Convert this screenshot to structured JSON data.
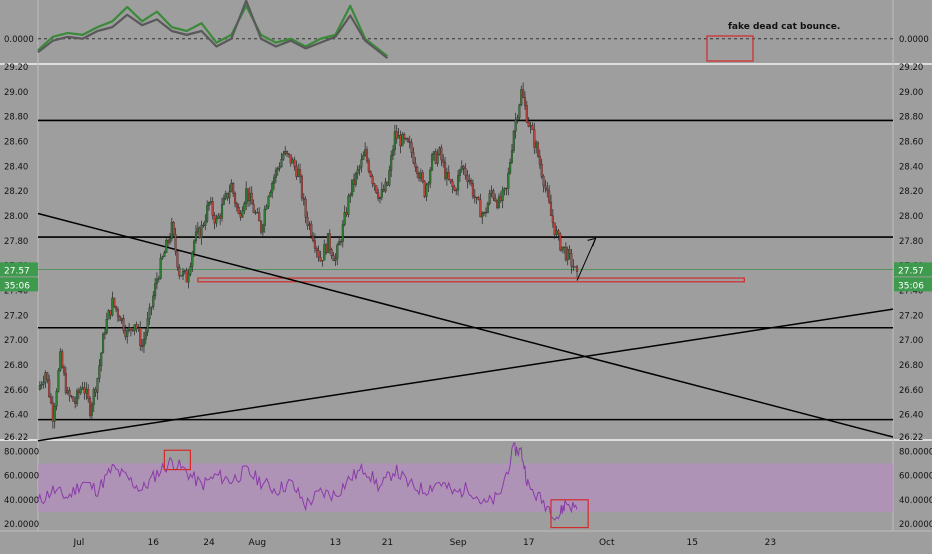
{
  "chart_data": [
    {
      "panel": "oscillator",
      "type": "line",
      "y_ticks": [
        "0.0000"
      ],
      "ylim": [
        -0.6,
        1.0
      ],
      "zero_line": true,
      "series": [
        {
          "color": "#3a8a3a",
          "x": [
            0,
            4,
            8,
            12,
            16,
            20,
            24,
            28,
            32,
            36,
            40,
            44,
            48,
            52,
            56,
            60,
            64,
            68,
            72,
            76,
            80,
            84,
            88,
            94
          ],
          "values": [
            -0.3,
            0.05,
            0.15,
            0.1,
            0.3,
            0.45,
            0.82,
            0.45,
            0.7,
            0.3,
            0.2,
            0.4,
            -0.1,
            0.1,
            0.85,
            0.1,
            -0.1,
            0.0,
            -0.2,
            0.0,
            0.1,
            0.85,
            0.0,
            -0.45
          ]
        },
        {
          "color": "#595959",
          "x": [
            0,
            4,
            8,
            12,
            16,
            20,
            24,
            28,
            32,
            36,
            40,
            44,
            48,
            52,
            56,
            60,
            64,
            68,
            72,
            76,
            80,
            84,
            88,
            94
          ],
          "values": [
            -0.35,
            -0.05,
            0.05,
            0.0,
            0.2,
            0.3,
            0.62,
            0.35,
            0.5,
            0.2,
            0.1,
            0.2,
            -0.2,
            0.0,
            0.98,
            0.0,
            -0.2,
            -0.05,
            -0.25,
            -0.1,
            0.05,
            0.6,
            -0.05,
            -0.5
          ]
        }
      ],
      "annotation": {
        "text": "fake dead cat bounce."
      }
    },
    {
      "panel": "price",
      "type": "candlestick",
      "y_ticks": [
        "29.20",
        "29.00",
        "28.80",
        "28.60",
        "28.40",
        "28.20",
        "28.00",
        "27.80",
        "27.60",
        "27.40",
        "27.20",
        "27.00",
        "26.80",
        "26.60",
        "26.40",
        "26.22"
      ],
      "ylim": [
        26.22,
        29.2
      ],
      "up_color": "#2f7d32",
      "down_color": "#b8433c",
      "close_points": [
        [
          0,
          26.6
        ],
        [
          2,
          26.75
        ],
        [
          4,
          26.4
        ],
        [
          6,
          26.85
        ],
        [
          8,
          26.55
        ],
        [
          10,
          26.5
        ],
        [
          12,
          26.65
        ],
        [
          14,
          26.45
        ],
        [
          16,
          26.7
        ],
        [
          18,
          27.1
        ],
        [
          20,
          27.3
        ],
        [
          22,
          27.2
        ],
        [
          24,
          27.05
        ],
        [
          26,
          27.15
        ],
        [
          28,
          26.95
        ],
        [
          30,
          27.2
        ],
        [
          32,
          27.5
        ],
        [
          34,
          27.7
        ],
        [
          36,
          27.9
        ],
        [
          38,
          27.55
        ],
        [
          40,
          27.5
        ],
        [
          42,
          27.8
        ],
        [
          44,
          27.9
        ],
        [
          46,
          28.1
        ],
        [
          48,
          27.95
        ],
        [
          50,
          28.1
        ],
        [
          52,
          28.25
        ],
        [
          54,
          28.0
        ],
        [
          56,
          28.2
        ],
        [
          58,
          28.05
        ],
        [
          60,
          27.9
        ],
        [
          62,
          28.2
        ],
        [
          64,
          28.35
        ],
        [
          66,
          28.5
        ],
        [
          68,
          28.45
        ],
        [
          70,
          28.35
        ],
        [
          72,
          28.0
        ],
        [
          74,
          27.85
        ],
        [
          76,
          27.65
        ],
        [
          78,
          27.8
        ],
        [
          80,
          27.65
        ],
        [
          82,
          27.9
        ],
        [
          84,
          28.2
        ],
        [
          86,
          28.35
        ],
        [
          88,
          28.5
        ],
        [
          90,
          28.3
        ],
        [
          92,
          28.15
        ],
        [
          94,
          28.25
        ],
        [
          96,
          28.65
        ],
        [
          98,
          28.6
        ],
        [
          100,
          28.55
        ],
        [
          102,
          28.4
        ],
        [
          104,
          28.2
        ],
        [
          106,
          28.45
        ],
        [
          108,
          28.5
        ],
        [
          110,
          28.3
        ],
        [
          112,
          28.2
        ],
        [
          114,
          28.4
        ],
        [
          116,
          28.3
        ],
        [
          118,
          28.1
        ],
        [
          120,
          28.0
        ],
        [
          122,
          28.2
        ],
        [
          124,
          28.1
        ],
        [
          126,
          28.2
        ],
        [
          128,
          28.7
        ],
        [
          130,
          29.0
        ],
        [
          132,
          28.75
        ],
        [
          134,
          28.55
        ],
        [
          136,
          28.3
        ],
        [
          138,
          28.0
        ],
        [
          140,
          27.8
        ],
        [
          142,
          27.7
        ],
        [
          144,
          27.6
        ],
        [
          145,
          27.5
        ]
      ],
      "horizontal_lines": [
        28.77,
        27.83,
        27.1,
        26.36
      ],
      "current_price_line": 27.57,
      "price_label": "27.57",
      "timer_label": "35:06",
      "support_box": {
        "from_x": 43,
        "to_x": 190,
        "low": 27.47,
        "high": 27.5
      },
      "trend_down": {
        "x": [
          0,
          230
        ],
        "y": [
          28.02,
          26.22
        ]
      },
      "trend_up": {
        "x": [
          0,
          230
        ],
        "y": [
          26.19,
          27.25
        ]
      },
      "projection_arrow": {
        "x": [
          145,
          150
        ],
        "y": [
          27.48,
          27.82
        ]
      }
    },
    {
      "panel": "rsi",
      "type": "line",
      "color": "#8a3aa8",
      "band_color": "#b68fc0",
      "band": [
        30,
        70
      ],
      "y_ticks": [
        "80.0000",
        "60.0000",
        "40.0000",
        "20.0000"
      ],
      "ylim": [
        15,
        87
      ],
      "x": [
        0,
        4,
        8,
        12,
        16,
        20,
        24,
        28,
        32,
        36,
        40,
        44,
        48,
        52,
        56,
        60,
        64,
        68,
        72,
        76,
        80,
        84,
        88,
        92,
        96,
        100,
        104,
        108,
        112,
        116,
        120,
        124,
        128,
        130,
        132,
        136,
        140,
        142,
        145
      ],
      "values": [
        38,
        48,
        42,
        55,
        48,
        66,
        58,
        48,
        62,
        72,
        63,
        52,
        60,
        56,
        64,
        55,
        48,
        54,
        36,
        46,
        44,
        58,
        66,
        50,
        65,
        52,
        48,
        55,
        45,
        50,
        36,
        42,
        82,
        80,
        50,
        38,
        26,
        38,
        32
      ],
      "highlight_boxes": [
        {
          "x": [
            34,
            41
          ],
          "y": [
            65,
            81
          ]
        },
        {
          "x": [
            138,
            148
          ],
          "y": [
            17,
            40
          ]
        }
      ]
    }
  ],
  "x_axis": {
    "domain": [
      0,
      230
    ],
    "ticks": [
      {
        "x": 11,
        "label": "Jul"
      },
      {
        "x": 31,
        "label": "16"
      },
      {
        "x": 46,
        "label": "24"
      },
      {
        "x": 59,
        "label": "Aug"
      },
      {
        "x": 80,
        "label": "13"
      },
      {
        "x": 94,
        "label": "21"
      },
      {
        "x": 113,
        "label": "Sep"
      },
      {
        "x": 132,
        "label": "17"
      },
      {
        "x": 153,
        "label": "Oct"
      },
      {
        "x": 176,
        "label": "15"
      },
      {
        "x": 197,
        "label": "23"
      }
    ]
  }
}
